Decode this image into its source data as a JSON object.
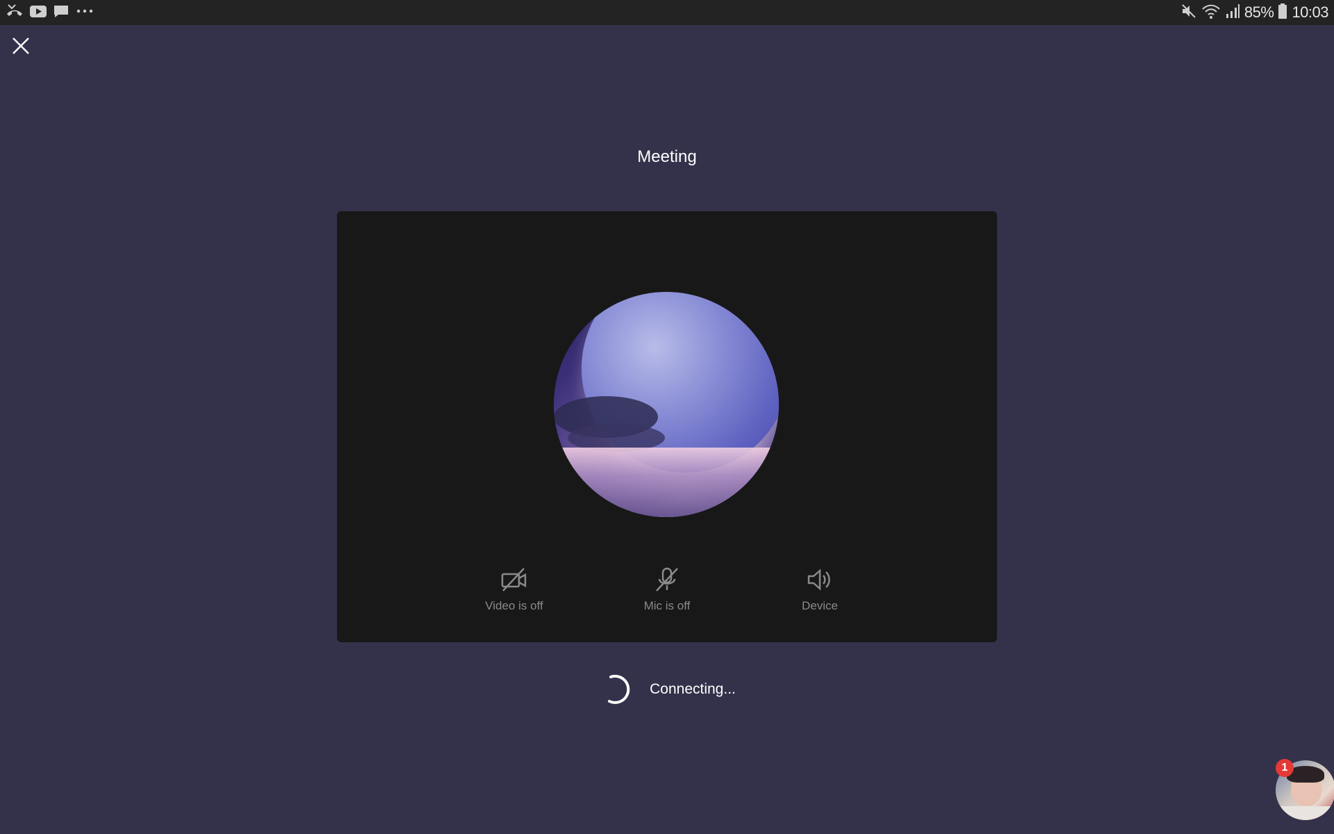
{
  "status_bar": {
    "left_icons": [
      "missed-call-icon",
      "youtube-icon",
      "message-icon",
      "more-dots-icon"
    ],
    "right_icons": [
      "mute-icon",
      "wifi-icon",
      "signal-icon",
      "battery-icon"
    ],
    "battery": "85%",
    "time": "10:03"
  },
  "header": {
    "close_icon": "close-icon",
    "title": "Meeting"
  },
  "preview": {
    "avatar": "profile-avatar",
    "controls": [
      {
        "icon": "video-off-icon",
        "label": "Video is off"
      },
      {
        "icon": "mic-off-icon",
        "label": "Mic is off"
      },
      {
        "icon": "speaker-icon",
        "label": "Device"
      }
    ]
  },
  "status": {
    "spinner_icon": "loading-spinner-icon",
    "text": "Connecting..."
  },
  "chat_head": {
    "badge_count": "1"
  },
  "colors": {
    "background": "#34324a",
    "preview_panel": "#181818",
    "status_bar": "#232323",
    "badge": "#e53935"
  }
}
